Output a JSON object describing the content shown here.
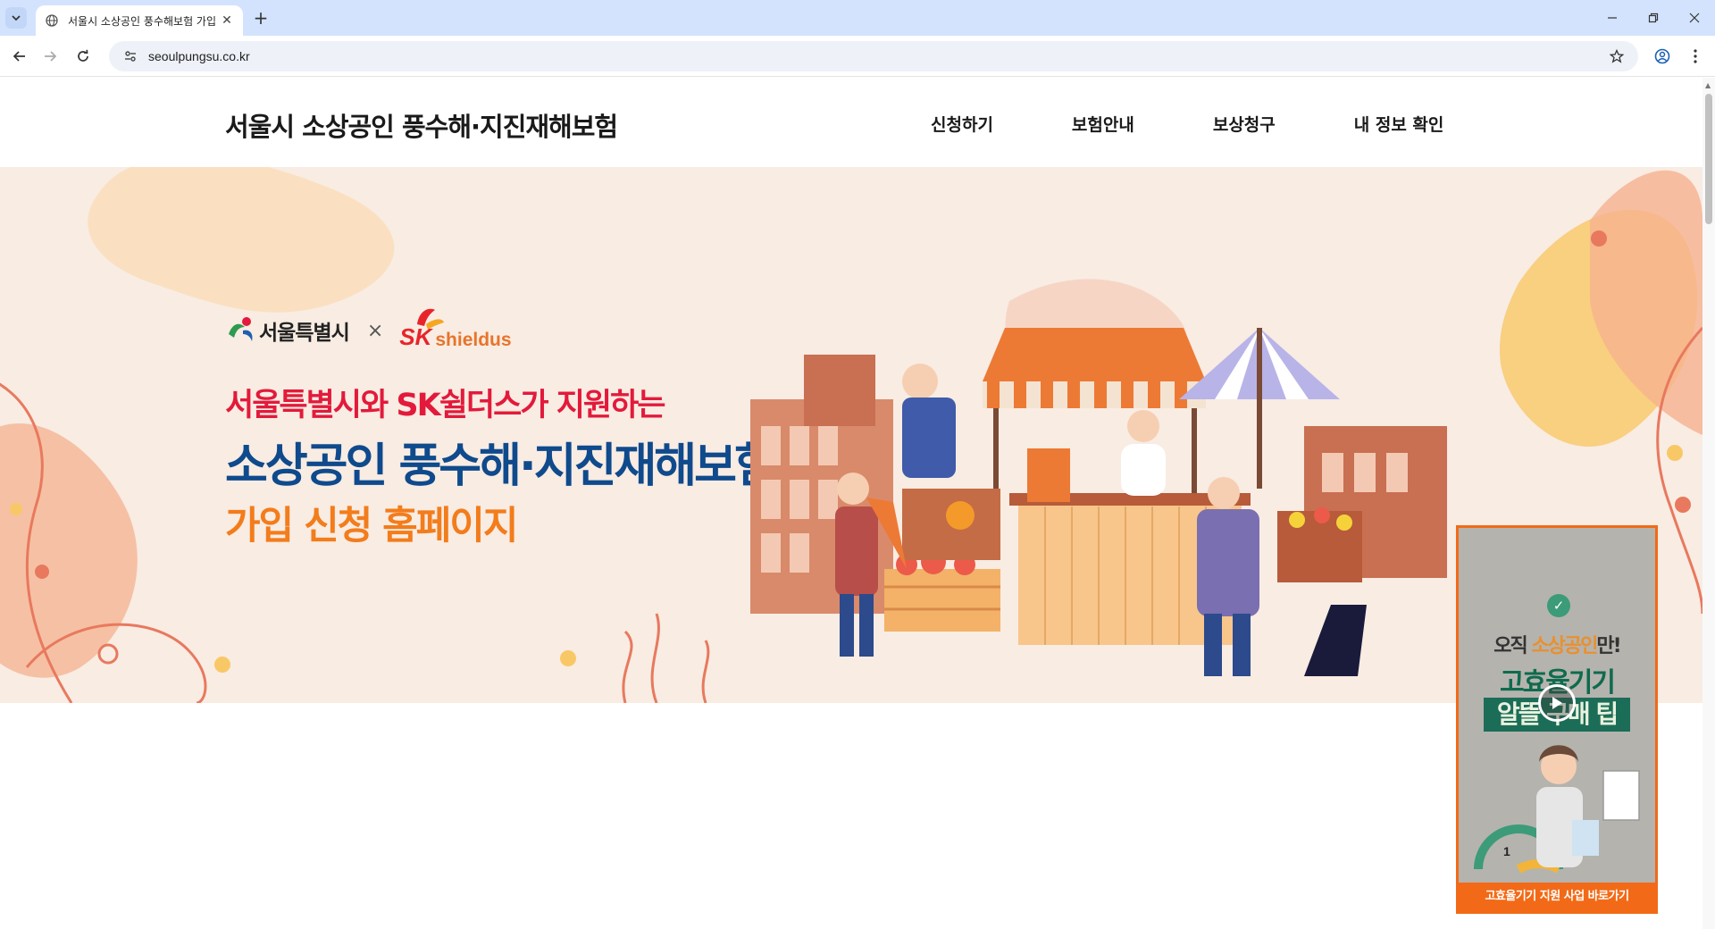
{
  "browser": {
    "tab_title": "서울시 소상공인 풍수해보험 가입",
    "url": "seoulpungsu.co.kr"
  },
  "header": {
    "site_title": "서울시 소상공인 풍수해·지진재해보험",
    "nav": [
      {
        "label": "신청하기"
      },
      {
        "label": "보험안내"
      },
      {
        "label": "보상청구"
      },
      {
        "label": "내 정보 확인"
      }
    ]
  },
  "hero": {
    "logo_seoul": "서울특별시",
    "logo_times": "×",
    "logo_sk": "SK",
    "logo_shieldus": "shieldus",
    "subtitle": "서울특별시와 SK쉴더스가 지원하는",
    "title": "소상공인 풍수해·지진재해보험",
    "tagline": "가입 신청 홈페이지"
  },
  "float_banner": {
    "line1_prefix": "오직 ",
    "line1_highlight": "소상공인",
    "line1_suffix": "만!",
    "line2": "고효율기기",
    "line3": "알뜰 구매 팁",
    "cta": "고효율기기 지원 사업 바로가기"
  },
  "icons": [
    "chevron-down-icon",
    "globe-icon",
    "close-icon",
    "plus-icon",
    "minimize-icon",
    "restore-icon",
    "back-icon",
    "forward-icon",
    "reload-icon",
    "site-info-icon",
    "star-icon",
    "profile-icon",
    "menu-icon",
    "play-icon",
    "check-icon"
  ],
  "colors": {
    "brand_red": "#e31a3b",
    "brand_blue": "#0f4a8c",
    "brand_orange": "#f37c1b",
    "hero_bg": "#f8ece3",
    "banner_border": "#f26a17"
  }
}
